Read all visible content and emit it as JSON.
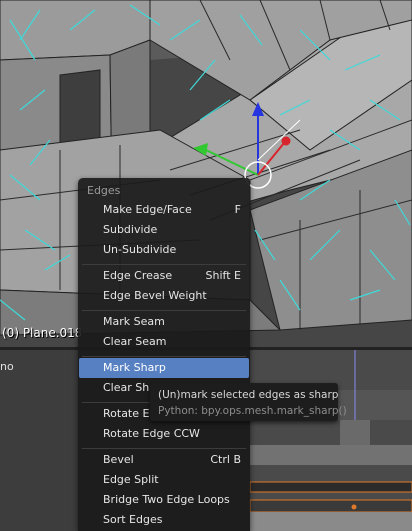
{
  "viewport": {
    "object_label": "(0) Plane.018"
  },
  "lower_pane": {
    "label": "no"
  },
  "menu": {
    "title": "Edges",
    "items": [
      {
        "label": "Make Edge/Face",
        "shortcut": "F"
      },
      {
        "label": "Subdivide",
        "shortcut": ""
      },
      {
        "label": "Un-Subdivide",
        "shortcut": ""
      },
      {
        "label": "Edge Crease",
        "shortcut": "Shift E"
      },
      {
        "label": "Edge Bevel Weight",
        "shortcut": ""
      },
      {
        "label": "Mark Seam",
        "shortcut": ""
      },
      {
        "label": "Clear Seam",
        "shortcut": ""
      },
      {
        "label": "Mark Sharp",
        "shortcut": "",
        "active": true
      },
      {
        "label": "Clear Sharp",
        "shortcut": ""
      },
      {
        "label": "Rotate Edge CW",
        "shortcut": ""
      },
      {
        "label": "Rotate Edge CCW",
        "shortcut": ""
      },
      {
        "label": "Bevel",
        "shortcut": "Ctrl B"
      },
      {
        "label": "Edge Split",
        "shortcut": ""
      },
      {
        "label": "Bridge Two Edge Loops",
        "shortcut": ""
      },
      {
        "label": "Sort Edges",
        "shortcut": ""
      }
    ]
  },
  "tooltip": {
    "description": "(Un)mark selected edges as sharp",
    "python": "Python: bpy.ops.mesh.mark_sharp()"
  },
  "colors": {
    "highlight": "#5680c2",
    "normals": "#3fd9d9",
    "axis_x": "#d8242c",
    "axis_y": "#32c832",
    "axis_z": "#2535e0"
  }
}
